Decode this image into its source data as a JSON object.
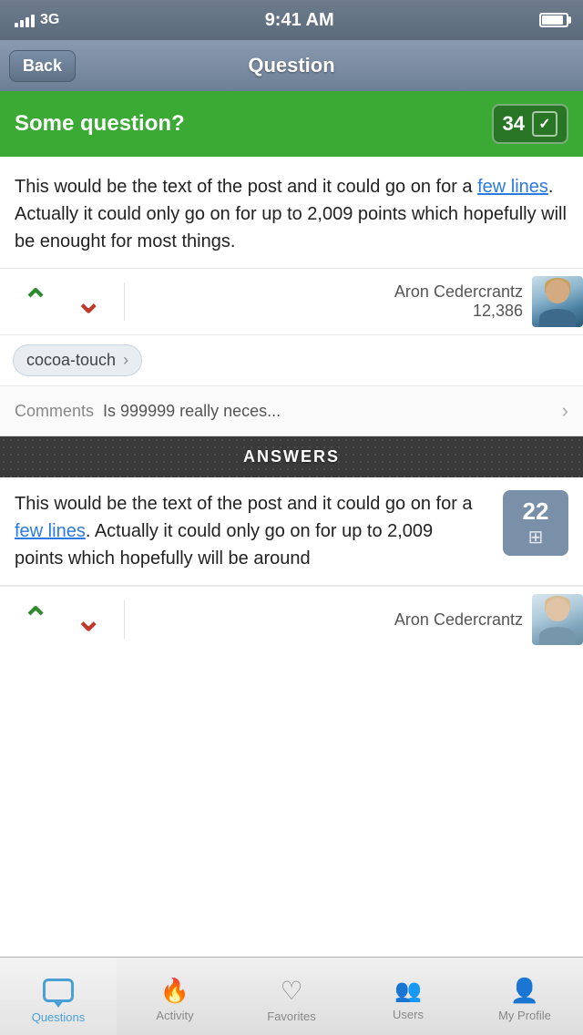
{
  "status_bar": {
    "signal": "3G",
    "time": "9:41 AM",
    "battery_level": "90%"
  },
  "nav": {
    "back_label": "Back",
    "title": "Question"
  },
  "question": {
    "title": "Some question?",
    "vote_count": "34",
    "post_text_before_link": "This would be the text of the post and it could go on for a ",
    "link_text": "few lines",
    "post_text_after_link": ". Actually it could only go on for up to 2,009 points which hopefully will be enought for most things.",
    "author_name": "Aron Cedercrantz",
    "author_score": "12,386",
    "tag": "cocoa-touch",
    "comments_label": "Comments",
    "comments_preview": "Is 999999 really neces..."
  },
  "answers": {
    "section_title": "ANSWERS",
    "vote_count": "22",
    "answer_text_before_link": "This would be the text of the post and it could go on for a ",
    "link_text": "few lines",
    "answer_text_after_link": ". Actually it could only go on for up to 2,009 points which hopefully will be around",
    "author_name": "Aron Cedercrantz"
  },
  "tab_bar": {
    "tabs": [
      {
        "id": "questions",
        "label": "Questions",
        "active": true
      },
      {
        "id": "activity",
        "label": "Activity",
        "active": false
      },
      {
        "id": "favorites",
        "label": "Favorites",
        "active": false
      },
      {
        "id": "users",
        "label": "Users",
        "active": false
      },
      {
        "id": "my-profile",
        "label": "My Profile",
        "active": false
      }
    ]
  },
  "colors": {
    "green": "#3aaa35",
    "blue": "#4a9fd4",
    "dark_red": "#c0392b"
  }
}
